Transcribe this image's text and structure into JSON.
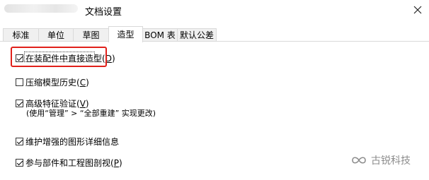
{
  "window": {
    "title": "文档设置"
  },
  "tabs": [
    {
      "label": "标准",
      "active": false
    },
    {
      "label": "单位",
      "active": false
    },
    {
      "label": "草图",
      "active": false
    },
    {
      "label": "造型",
      "active": true
    },
    {
      "label": "BOM 表",
      "active": false
    },
    {
      "label": "默认公差",
      "active": false
    }
  ],
  "options": [
    {
      "label": "在装配件中直接造型",
      "key": "D",
      "checked": true,
      "highlighted": true
    },
    {
      "label": "压缩模型历史",
      "key": "C",
      "checked": false
    },
    {
      "label": "高级特征验证",
      "key": "V",
      "checked": true,
      "note": "(使用“管理” > “全部重建” 实现更改)"
    },
    {
      "label": "维护增强的图形详细信息",
      "key": "",
      "checked": true
    },
    {
      "label": "参与部件和工程图剖视",
      "key": "P",
      "checked": true
    }
  ],
  "watermark": {
    "text": "古锐科技",
    "icon": "wechat-channel-icon"
  },
  "colors": {
    "highlight": "#e0201a",
    "tab_border": "#d9d9d9",
    "watermark": "#8c8c8c"
  }
}
